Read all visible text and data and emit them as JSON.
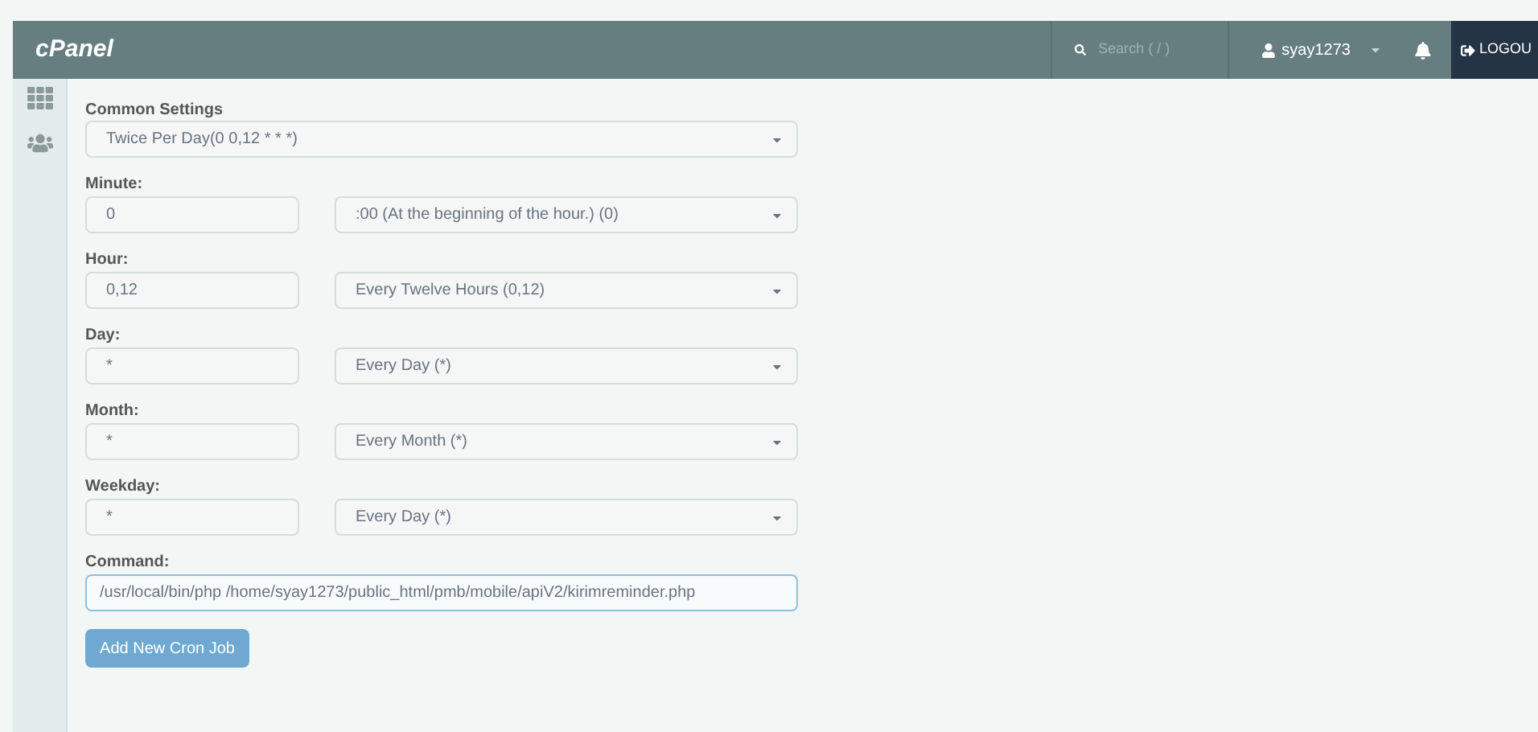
{
  "header": {
    "logo": "cPanel",
    "search": {
      "placeholder": "Search ( / )"
    },
    "user": "syay1273",
    "logout": "LOGOU"
  },
  "sidebar": {
    "items": [
      {
        "kind": "grid"
      },
      {
        "kind": "users"
      }
    ]
  },
  "form": {
    "common_settings": {
      "label": "Common Settings",
      "value": "Twice Per Day(0 0,12 * * *)"
    },
    "fields": [
      {
        "label": "Minute:",
        "value": "0",
        "option": ":00 (At the beginning of the hour.) (0)"
      },
      {
        "label": "Hour:",
        "value": "0,12",
        "option": "Every Twelve Hours (0,12)"
      },
      {
        "label": "Day:",
        "value": "*",
        "option": "Every Day (*)"
      },
      {
        "label": "Month:",
        "value": "*",
        "option": "Every Month (*)"
      },
      {
        "label": "Weekday:",
        "value": "*",
        "option": "Every Day (*)"
      }
    ],
    "command": {
      "label": "Command:",
      "value": "/usr/local/bin/php /home/syay1273/public_html/pmb/mobile/apiV2/kirimreminder.php"
    },
    "submit": "Add New Cron Job"
  }
}
